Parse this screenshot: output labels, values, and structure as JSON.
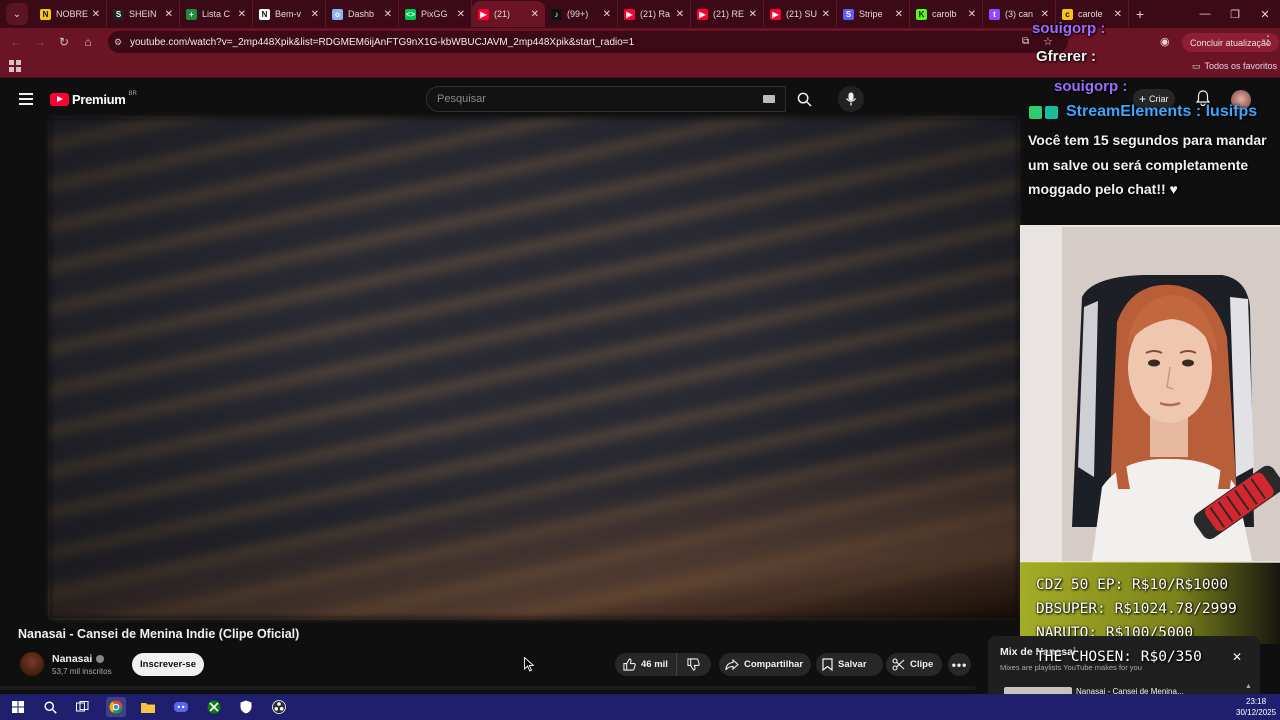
{
  "browser": {
    "tabs": [
      {
        "label": "NOBRE",
        "icon": "tab-nobre-icon",
        "color": "#f5c518",
        "glyph": "N"
      },
      {
        "label": "SHEIN",
        "icon": "tab-shein-icon",
        "color": "#222222",
        "glyph": "S"
      },
      {
        "label": "Lista C",
        "icon": "tab-sheets-icon",
        "color": "#1e8e3e",
        "glyph": "+"
      },
      {
        "label": "Bem-v",
        "icon": "tab-notion-icon",
        "color": "#ffffff",
        "glyph": "N"
      },
      {
        "label": "Dashb",
        "icon": "tab-globe-icon",
        "color": "#8ab4f8",
        "glyph": "o"
      },
      {
        "label": "PixGG",
        "icon": "tab-pixgg-icon",
        "color": "#00c853",
        "glyph": "<>"
      },
      {
        "label": "(21)",
        "icon": "tab-youtube-icon",
        "color": "#ff0033",
        "glyph": "▶",
        "active": true
      },
      {
        "label": "(99+)",
        "icon": "tab-tiktok-icon",
        "color": "#111111",
        "glyph": "♪"
      },
      {
        "label": "(21) Ra",
        "icon": "tab-youtube-icon",
        "color": "#ff0033",
        "glyph": "▶"
      },
      {
        "label": "(21) RE",
        "icon": "tab-youtube-icon",
        "color": "#ff0033",
        "glyph": "▶"
      },
      {
        "label": "(21) SU",
        "icon": "tab-youtube-icon",
        "color": "#ff0033",
        "glyph": "▶"
      },
      {
        "label": "Stripe",
        "icon": "tab-stripe-icon",
        "color": "#635bff",
        "glyph": "S"
      },
      {
        "label": "carolb",
        "icon": "tab-kick-icon",
        "color": "#53fc18",
        "glyph": "K"
      },
      {
        "label": "(3) can",
        "icon": "tab-twitch-icon",
        "color": "#9146ff",
        "glyph": "t"
      },
      {
        "label": "carole",
        "icon": "tab-misc-icon",
        "color": "#f5c518",
        "glyph": "c"
      }
    ],
    "url": "youtube.com/watch?v=_2mp448Xpik&list=RDGMEM6ijAnFTG9nX1G-kbWBUCJAVM_2mp448Xpik&start_radio=1",
    "update_button": "Concluir atualização",
    "all_favorites": "Todos os favoritos"
  },
  "youtube": {
    "logo_text": "Premium",
    "region": "BR",
    "search_placeholder": "Pesquisar",
    "create_label": "Criar",
    "notification_count": "",
    "video_title": "Nanasai - Cansei de Menina Indie (Clipe Oficial)",
    "channel_name": "Nanasai",
    "subscribers": "53,7 mil inscritos",
    "subscribe_label": "Inscrever-se",
    "like_count": "46 mil",
    "share_label": "Compartilhar",
    "save_label": "Salvar",
    "clip_label": "Clipe",
    "mix_title": "Mix de Nanasai",
    "mix_subtitle": "Mixes are playlists YouTube makes for you",
    "mix_item": "Nanasai - Cansei de Menina..."
  },
  "overlay": {
    "chat_user_1": "souigorp :",
    "chat_user_2": "Gfrerer :",
    "chat_user_3": "souigorp :",
    "se_name": "StreamElements : lusifps",
    "se_message": "Você tem 15 segundos para mandar um salve ou será completamente moggado pelo chat!! ♥",
    "goals": [
      "CDZ 50 EP: R$10/R$1000",
      "DBSUPER: R$1024.78/2999",
      "NARUTO: R$100/5000",
      "THE CHOSEN: R$0/350"
    ]
  },
  "taskbar": {
    "time": "23:18",
    "date": "30/12/2025"
  },
  "colors": {
    "browser_frame": "#6b1426",
    "youtube_red": "#ff0033",
    "taskbar": "#1f1f6e",
    "goal_panel": "#b4be28"
  }
}
